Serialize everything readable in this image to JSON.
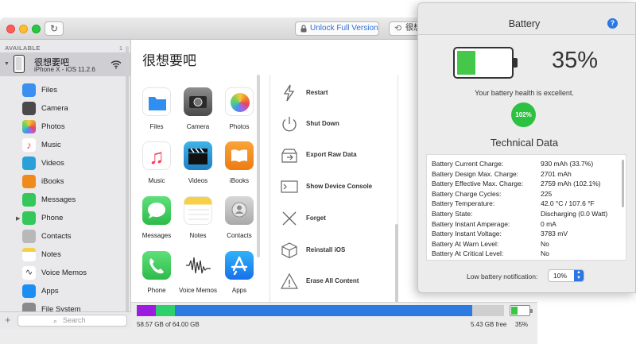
{
  "toolbar": {
    "refresh_glyph": "↻",
    "unlock_label": "Unlock Full Version",
    "restore_label": "很想"
  },
  "sidebar": {
    "section": "AVAILABLE",
    "section_count": "1",
    "device_name": "很想要吧",
    "device_sub": "iPhone X - iOS 11.2.6",
    "items": [
      {
        "label": "Files",
        "color": "#3a8ff0"
      },
      {
        "label": "Camera",
        "color": "#4a4a4a"
      },
      {
        "label": "Photos",
        "color": "#f0a030"
      },
      {
        "label": "Music",
        "color": "#fc3d5b"
      },
      {
        "label": "Videos",
        "color": "#2aa0d8"
      },
      {
        "label": "iBooks",
        "color": "#f08a1c"
      },
      {
        "label": "Messages",
        "color": "#34c759"
      },
      {
        "label": "Phone",
        "color": "#34c759"
      },
      {
        "label": "Contacts",
        "color": "#b8b8b8"
      },
      {
        "label": "Notes",
        "color": "#f6d047"
      },
      {
        "label": "Voice Memos",
        "color": "#ffffff"
      },
      {
        "label": "Apps",
        "color": "#1a8ef5"
      },
      {
        "label": "File System",
        "color": "#8a8a8a"
      }
    ],
    "search_placeholder": "Search"
  },
  "main": {
    "title": "很想要吧",
    "apps": [
      {
        "label": "Files"
      },
      {
        "label": "Camera"
      },
      {
        "label": "Photos"
      },
      {
        "label": "Music"
      },
      {
        "label": "Videos"
      },
      {
        "label": "iBooks"
      },
      {
        "label": "Messages"
      },
      {
        "label": "Notes"
      },
      {
        "label": "Contacts"
      },
      {
        "label": "Phone"
      },
      {
        "label": "Voice Memos"
      },
      {
        "label": "Apps"
      }
    ],
    "actions": [
      {
        "label": "Restart"
      },
      {
        "label": "Shut Down"
      },
      {
        "label": "Export Raw Data"
      },
      {
        "label": "Show Device Console"
      },
      {
        "label": "Forget"
      },
      {
        "label": "Reinstall iOS"
      },
      {
        "label": "Erase All Content"
      }
    ]
  },
  "storage": {
    "used_label": "58.57 GB of 64.00 GB",
    "free_label": "5.43 GB free",
    "battery_pct": "35%",
    "segments": [
      {
        "color": "#9b1de0",
        "fraction": 0.052
      },
      {
        "color": "#2fcf6b",
        "fraction": 0.052
      },
      {
        "color": "#2d7ae0",
        "fraction": 0.81
      },
      {
        "color": "#cfcfcf",
        "fraction": 0.086
      }
    ]
  },
  "battery": {
    "title": "Battery",
    "help": "?",
    "percent": "35%",
    "level": 0.35,
    "health_text": "Your battery health is excellent.",
    "health_badge": "102%",
    "tech_title": "Technical Data",
    "rows": [
      {
        "k": "Battery Current Charge:",
        "v": "930 mAh (33.7%)"
      },
      {
        "k": "Battery Design Max. Charge:",
        "v": "2701 mAh"
      },
      {
        "k": "Battery Effective Max. Charge:",
        "v": "2759 mAh (102.1%)"
      },
      {
        "k": "Battery Charge Cycles:",
        "v": "225"
      },
      {
        "k": "Battery Temperature:",
        "v": "42.0 °C / 107.6 °F"
      },
      {
        "k": "Battery State:",
        "v": "Discharging (0.0 Watt)"
      },
      {
        "k": "Battery Instant Amperage:",
        "v": "0 mA"
      },
      {
        "k": "Battery Instant Voltage:",
        "v": "3783 mV"
      },
      {
        "k": "Battery At Warn Level:",
        "v": "No"
      },
      {
        "k": "Battery At Critical Level:",
        "v": "No"
      }
    ],
    "notif_label": "Low battery notification:",
    "notif_value": "10%"
  },
  "colors": {
    "accent": "#2b77e3",
    "battery_green": "#45c74a",
    "link_blue": "#2d6fd6"
  }
}
